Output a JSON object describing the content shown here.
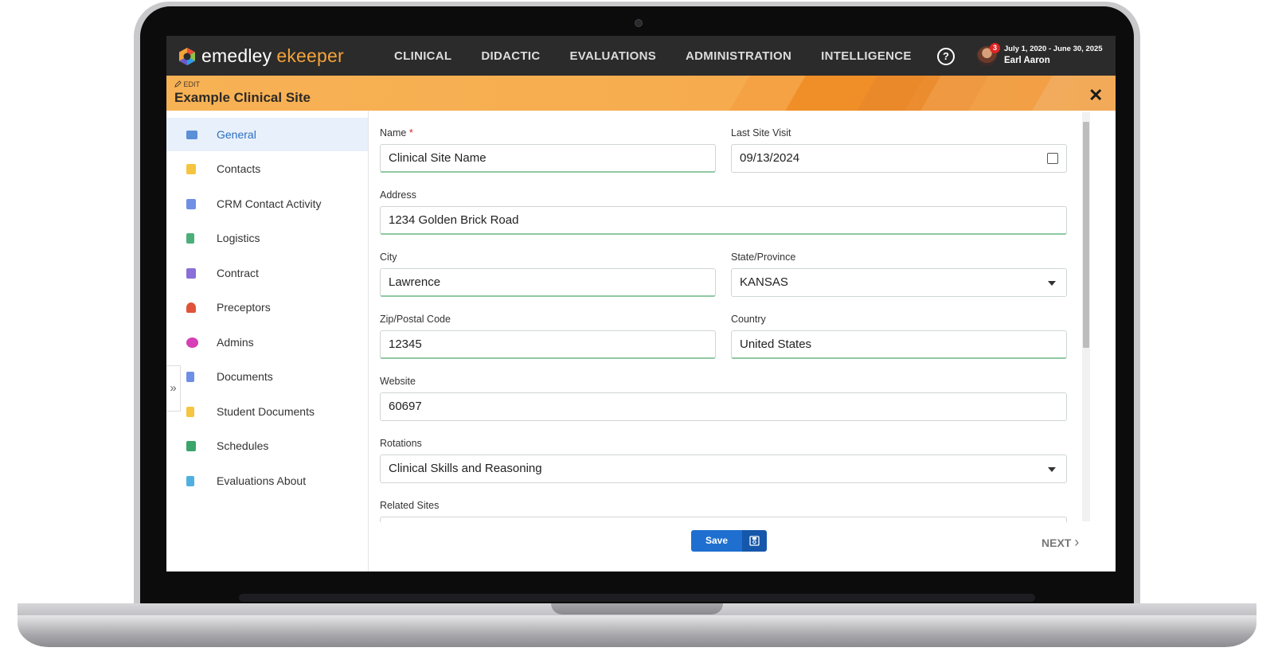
{
  "app": {
    "brand_main": "emedley",
    "brand_product": "ekeeper"
  },
  "nav": {
    "items": [
      {
        "label": "CLINICAL"
      },
      {
        "label": "DIDACTIC"
      },
      {
        "label": "EVALUATIONS"
      },
      {
        "label": "ADMINISTRATION"
      },
      {
        "label": "INTELLIGENCE"
      }
    ],
    "help_icon": "question-circle-icon"
  },
  "user": {
    "notification_count": "3",
    "date_range": "July 1, 2020 - June 30, 2025",
    "name": "Earl Aaron"
  },
  "edit_header": {
    "mode_label": "EDIT",
    "title": "Example Clinical Site",
    "close_symbol": "✕"
  },
  "sidebar": {
    "items": [
      {
        "label": "General",
        "icon": "id-card-icon",
        "active": true
      },
      {
        "label": "Contacts",
        "icon": "contact-card-icon"
      },
      {
        "label": "CRM Contact Activity",
        "icon": "mail-icon"
      },
      {
        "label": "Logistics",
        "icon": "clipboard-icon"
      },
      {
        "label": "Contract",
        "icon": "contract-edit-icon"
      },
      {
        "label": "Preceptors",
        "icon": "preceptor-icon"
      },
      {
        "label": "Admins",
        "icon": "users-group-icon"
      },
      {
        "label": "Documents",
        "icon": "document-icon"
      },
      {
        "label": "Student Documents",
        "icon": "student-document-icon"
      },
      {
        "label": "Schedules",
        "icon": "calendar-icon"
      },
      {
        "label": "Evaluations About",
        "icon": "evaluation-check-icon"
      }
    ],
    "collapse_symbol": "»"
  },
  "form": {
    "name": {
      "label": "Name",
      "required_marker": "*",
      "value": "Clinical Site Name"
    },
    "last_site_visit": {
      "label": "Last Site Visit",
      "value": "09/13/2024"
    },
    "address": {
      "label": "Address",
      "value": "1234 Golden Brick Road"
    },
    "city": {
      "label": "City",
      "value": "Lawrence"
    },
    "state": {
      "label": "State/Province",
      "value": "KANSAS"
    },
    "zip": {
      "label": "Zip/Postal Code",
      "value": "12345"
    },
    "country": {
      "label": "Country",
      "value": "United States"
    },
    "website": {
      "label": "Website",
      "value": "60697"
    },
    "rotations": {
      "label": "Rotations",
      "value": "Clinical Skills and Reasoning"
    },
    "related_sites": {
      "label": "Related Sites"
    }
  },
  "footer": {
    "save_label": "Save",
    "next_label": "NEXT",
    "next_symbol": "›"
  },
  "colors": {
    "accent_orange": "#f6ac4e",
    "nav_bg": "#2b2b2b",
    "primary_blue": "#1e6fd0",
    "active_item_bg": "#e8f0fb"
  }
}
